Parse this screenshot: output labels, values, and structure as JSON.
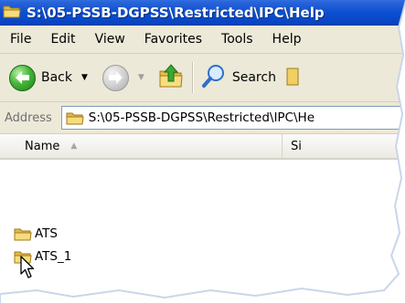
{
  "window": {
    "title": "S:\\05-PSSB-DGPSS\\Restricted\\IPC\\Help"
  },
  "menu": [
    "File",
    "Edit",
    "View",
    "Favorites",
    "Tools",
    "Help"
  ],
  "toolbar": {
    "back_label": "Back",
    "search_label": "Search"
  },
  "address": {
    "label": "Address",
    "value": "S:\\05-PSSB-DGPSS\\Restricted\\IPC\\He"
  },
  "columns": {
    "name": "Name",
    "size": "Si"
  },
  "files": [
    {
      "name": "ATS",
      "icon": "folder-icon"
    },
    {
      "name": "ATS_1",
      "icon": "folder-icon"
    }
  ],
  "colors": {
    "titlebar": "#0a4fd0",
    "chrome": "#ece9d8",
    "folder": "#f3d36b"
  }
}
